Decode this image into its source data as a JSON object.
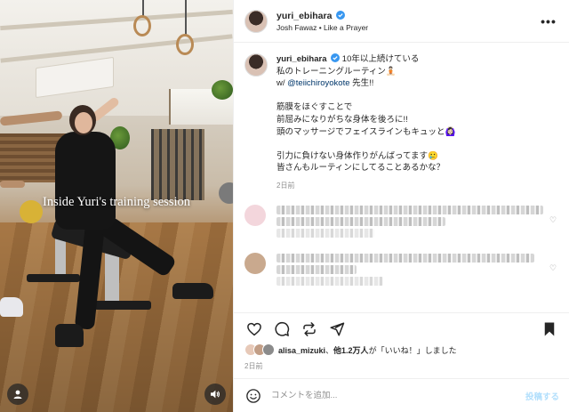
{
  "colors": {
    "accent": "#0095f6",
    "verified": "#3897f0",
    "text": "#262626",
    "muted": "#8e8e8e",
    "post_disabled": "#b2dffc"
  },
  "media": {
    "overlay_text": "Inside Yuri's training session",
    "user_tag_icon": "person-tag-icon",
    "mute_icon": "speaker-icon"
  },
  "header": {
    "username": "yuri_ebihara",
    "audio": "Josh Fawaz • Like a Prayer",
    "more": "•••"
  },
  "caption": {
    "username": "yuri_ebihara",
    "line1": "10年以上続けている",
    "line2": "私のトレーニングルーティン🧘🏻",
    "line3_prefix": "w/ ",
    "mention": "@teiichiroyokote",
    "line3_suffix": " 先生!!",
    "line4": "筋膜をほぐすことで",
    "line5": "前屈みになりがちな身体を後ろに!!",
    "line6": "頭のマッサージでフェイスラインもキュッと🙆🏻‍♀️",
    "line7": "引力に負けない身体作りがんばってます🥲",
    "line8": "皆さんもルーティンにしてることあるかな？",
    "time": "2日前"
  },
  "comments": [
    {
      "avatar_color": "#f3d6dc"
    },
    {
      "avatar_color": "#c9a98e"
    }
  ],
  "actions": {
    "like_icon": "heart-icon",
    "comment_icon": "comment-icon",
    "repost_icon": "repost-icon",
    "share_icon": "send-icon",
    "save_icon": "bookmark-icon"
  },
  "likes": {
    "first_user": "alisa_mizuki",
    "others": "他1.2万人",
    "suffix": "が「いいね！」しました"
  },
  "post_date": "2日前",
  "comment_box": {
    "placeholder": "コメントを追加...",
    "post_label": "投稿する"
  }
}
